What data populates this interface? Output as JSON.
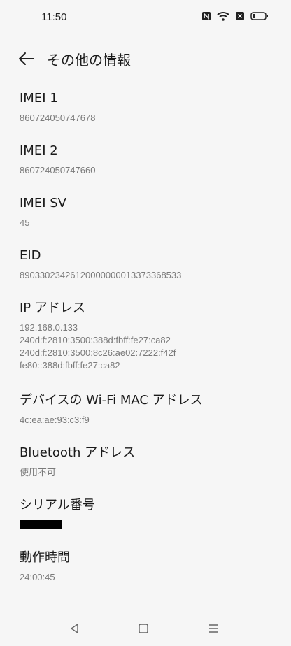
{
  "status_bar": {
    "time": "11:50",
    "icons": [
      "nfc-icon",
      "wifi-icon",
      "no-sim-icon",
      "battery-icon"
    ]
  },
  "app_bar": {
    "title": "その他の情報",
    "back_icon": "arrow-left-icon"
  },
  "items": [
    {
      "title": "IMEI 1",
      "value": "860724050747678"
    },
    {
      "title": "IMEI 2",
      "value": "860724050747660"
    },
    {
      "title": "IMEI SV",
      "value": "45"
    },
    {
      "title": "EID",
      "value": "89033023426120000000013373368533"
    },
    {
      "title": "IP アドレス",
      "value": "192.168.0.133\n240d:f:2810:3500:388d:fbff:fe27:ca82\n240d:f:2810:3500:8c26:ae02:7222:f42f\nfe80::388d:fbff:fe27:ca82"
    },
    {
      "title": "デバイスの Wi-Fi MAC アドレス",
      "value": "4c:ea:ae:93:c3:f9"
    },
    {
      "title": "Bluetooth アドレス",
      "value": "使用不可"
    },
    {
      "title": "シリアル番号",
      "value": ""
    },
    {
      "title": "動作時間",
      "value": "24:00:45"
    }
  ],
  "nav_bar": {
    "icons": [
      "back-triangle-icon",
      "home-square-icon",
      "recents-menu-icon"
    ]
  },
  "colors": {
    "background": "#f6f6f6",
    "text_primary": "#1a1a1a",
    "text_secondary": "#7a7a7a"
  }
}
